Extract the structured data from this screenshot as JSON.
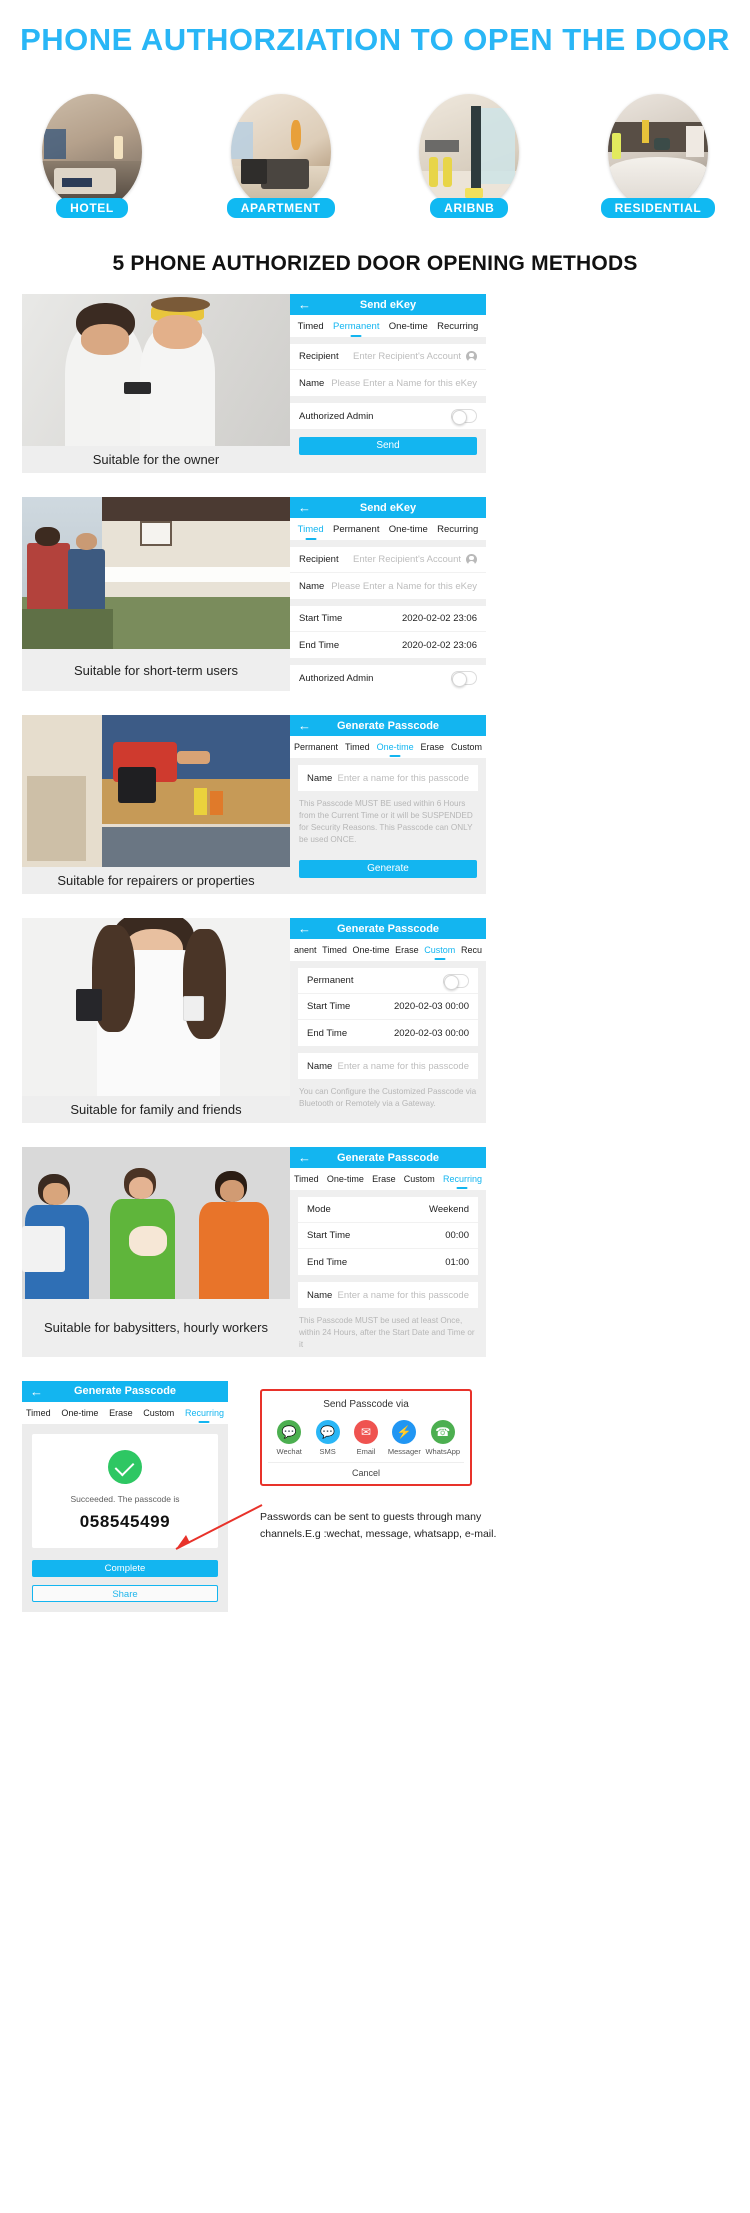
{
  "hero": {
    "title": "PHONE  AUTHORZIATION TO OPEN THE DOOR",
    "categories": [
      {
        "label": "HOTEL",
        "icon": "hotel-room-photo"
      },
      {
        "label": "APARTMENT",
        "icon": "apartment-living-room-photo"
      },
      {
        "label": "ARIBNB",
        "icon": "airbnb-kitchen-photo"
      },
      {
        "label": "RESIDENTIAL",
        "icon": "residential-bedroom-photo"
      }
    ]
  },
  "section_title": "5 PHONE AUTHORIZED DOOR OPENING METHODS",
  "features": [
    {
      "caption": "Suitable for the owner",
      "photo": "couple-with-phone-photo",
      "nav_title": "Send eKey",
      "back_icon": "back-arrow-icon",
      "tabs": [
        {
          "label": "Timed",
          "active": false
        },
        {
          "label": "Permanent",
          "active": true
        },
        {
          "label": "One-time",
          "active": false
        },
        {
          "label": "Recurring",
          "active": false
        }
      ],
      "rows": [
        {
          "label": "Recipient",
          "placeholder": "Enter Recipient's Account",
          "avatar": true
        },
        {
          "label": "Name",
          "placeholder": "Please Enter a Name for this eKey"
        }
      ],
      "toggle_row": {
        "label": "Authorized Admin",
        "state": "off"
      },
      "button": "Send"
    },
    {
      "caption": "Suitable for short-term users",
      "photo": "family-outside-house-photo",
      "nav_title": "Send eKey",
      "back_icon": "back-arrow-icon",
      "tabs": [
        {
          "label": "Timed",
          "active": true
        },
        {
          "label": "Permanent",
          "active": false
        },
        {
          "label": "One-time",
          "active": false
        },
        {
          "label": "Recurring",
          "active": false
        }
      ],
      "rows": [
        {
          "label": "Recipient",
          "placeholder": "Enter Recipient's Account",
          "avatar": true
        },
        {
          "label": "Name",
          "placeholder": "Please Enter a Name for this eKey"
        }
      ],
      "time_rows": [
        {
          "label": "Start Time",
          "value": "2020-02-02 23:06"
        },
        {
          "label": "End Time",
          "value": "2020-02-02 23:06"
        }
      ],
      "toggle_row": {
        "label": "Authorized Admin",
        "state": "off"
      }
    },
    {
      "caption": "Suitable for repairers or properties",
      "photo": "handyman-with-drill-photo",
      "nav_title": "Generate Passcode",
      "back_icon": "back-arrow-icon",
      "tabs": [
        {
          "label": "Permanent",
          "active": false
        },
        {
          "label": "Timed",
          "active": false
        },
        {
          "label": "One-time",
          "active": true
        },
        {
          "label": "Erase",
          "active": false
        },
        {
          "label": "Custom",
          "active": false
        }
      ],
      "rows": [
        {
          "label": "Name",
          "placeholder": "Enter a name for this passcode"
        }
      ],
      "note": "This Passcode MUST BE used within 6 Hours from the Current Time or it will be SUSPENDED for Security Reasons. This Passcode can ONLY be used ONCE.",
      "button": "Generate"
    },
    {
      "caption": "Suitable for family and friends",
      "photo": "woman-with-phone-photo",
      "nav_title": "Generate Passcode",
      "back_icon": "back-arrow-icon",
      "tabs": [
        {
          "label": "anent",
          "active": false
        },
        {
          "label": "Timed",
          "active": false
        },
        {
          "label": "One-time",
          "active": false
        },
        {
          "label": "Erase",
          "active": false
        },
        {
          "label": "Custom",
          "active": true
        },
        {
          "label": "Recu",
          "active": false
        }
      ],
      "toggle_row": {
        "label": "Permanent",
        "state": "off"
      },
      "time_rows": [
        {
          "label": "Start Time",
          "value": "2020-02-03 00:00"
        },
        {
          "label": "End Time",
          "value": "2020-02-03 00:00"
        }
      ],
      "rows": [
        {
          "label": "Name",
          "placeholder": "Enter a name for this passcode"
        }
      ],
      "note": "You can Configure the Customized Passcode via Bluetooth or Remotely via a Gateway."
    },
    {
      "caption": "Suitable for babysitters, hourly workers",
      "photo": "three-workers-photo",
      "nav_title": "Generate Passcode",
      "back_icon": "back-arrow-icon",
      "tabs": [
        {
          "label": "Timed",
          "active": false
        },
        {
          "label": "One-time",
          "active": false
        },
        {
          "label": "Erase",
          "active": false
        },
        {
          "label": "Custom",
          "active": false
        },
        {
          "label": "Recurring",
          "active": true
        }
      ],
      "mode_rows": [
        {
          "label": "Mode",
          "value": "Weekend"
        },
        {
          "label": "Start Time",
          "value": "00:00"
        },
        {
          "label": "End Time",
          "value": "01:00"
        }
      ],
      "rows": [
        {
          "label": "Name",
          "placeholder": "Enter a name for this passcode"
        }
      ],
      "note": "This Passcode MUST be used at least Once, within 24 Hours, after the Start Date and Time or it"
    }
  ],
  "result": {
    "nav_title": "Generate Passcode",
    "back_icon": "back-arrow-icon",
    "tabs": [
      {
        "label": "Timed",
        "active": false
      },
      {
        "label": "One-time",
        "active": false
      },
      {
        "label": "Erase",
        "active": false
      },
      {
        "label": "Custom",
        "active": false
      },
      {
        "label": "Recurring",
        "active": true
      }
    ],
    "success_icon": "success-check-icon",
    "success_text": "Succeeded. The passcode is",
    "passcode": "058545499",
    "complete_button": "Complete",
    "share_button": "Share"
  },
  "share": {
    "title": "Send Passcode via",
    "channels": [
      {
        "name": "Wechat",
        "icon": "wechat-icon",
        "color": "#4caf50",
        "glyph": "✉"
      },
      {
        "name": "SMS",
        "icon": "sms-icon",
        "color": "#29b6f6",
        "glyph": "✉"
      },
      {
        "name": "Email",
        "icon": "email-icon",
        "color": "#ef5350",
        "glyph": "✉"
      },
      {
        "name": "Messager",
        "icon": "messenger-icon",
        "color": "#2196f3",
        "glyph": "⚡"
      },
      {
        "name": "WhatsApp",
        "icon": "whatsapp-icon",
        "color": "#4caf50",
        "glyph": "✆"
      }
    ],
    "cancel": "Cancel"
  },
  "bottom_note": "Passwords can be sent to guests through many channels.E.g :wechat,  message,  whatsapp,  e-mail.",
  "colors": {
    "accent": "#13b5f0",
    "hero_title": "#29b6f6",
    "success_green": "#2ec763",
    "highlight_border": "#e8322a"
  }
}
